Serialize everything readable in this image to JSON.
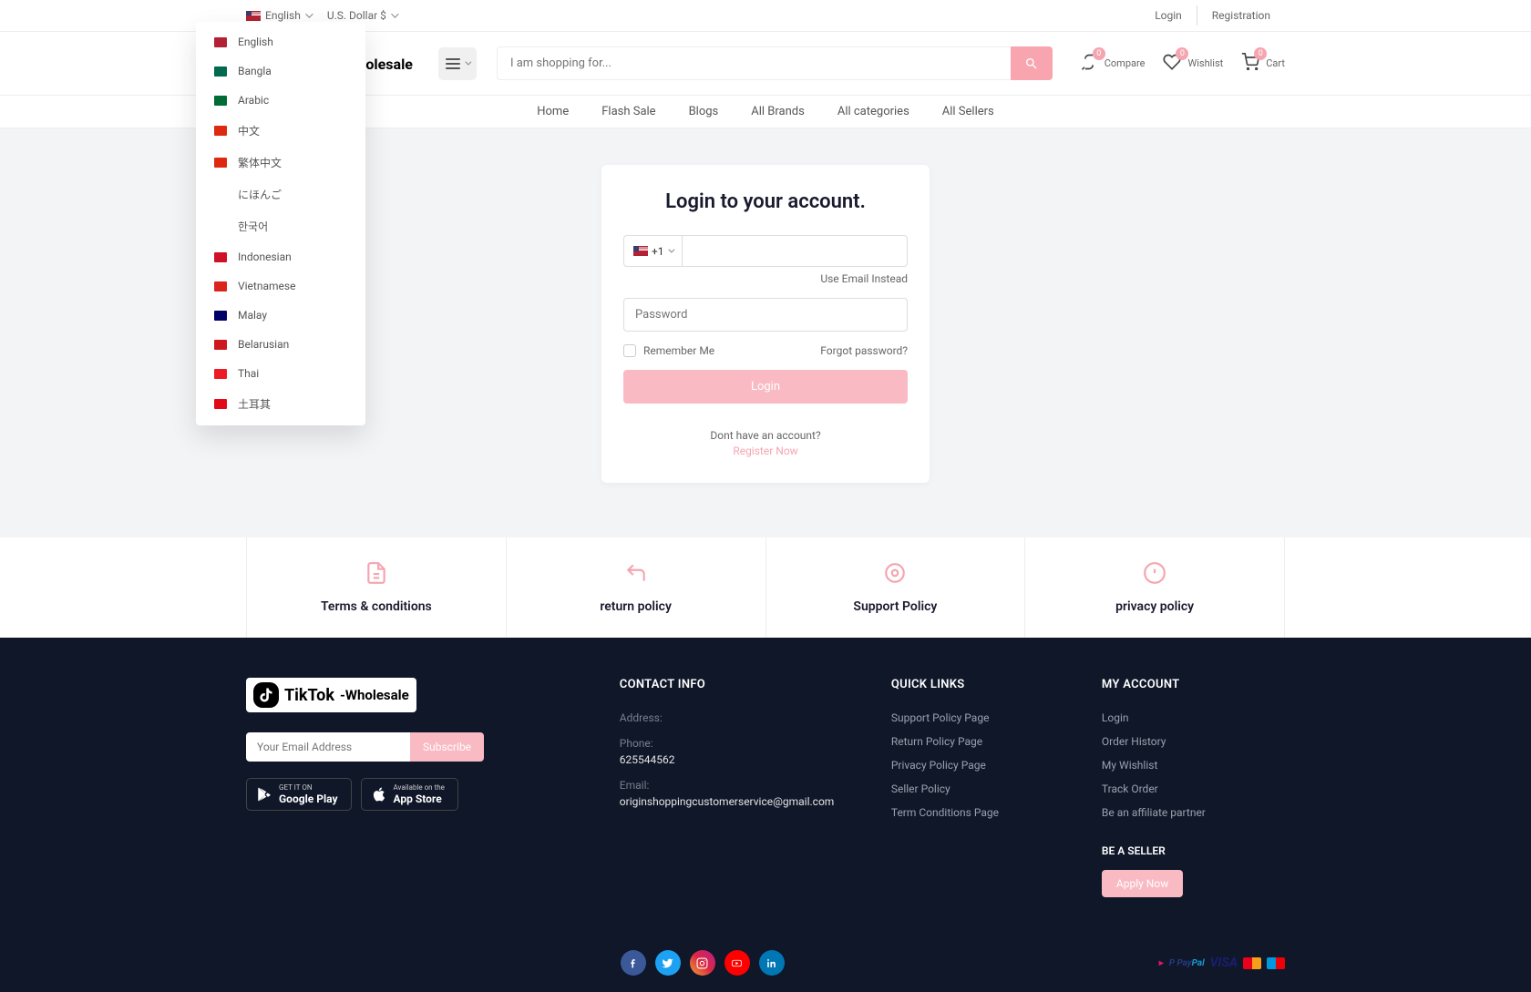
{
  "topbar": {
    "language": "English",
    "currency": "U.S. Dollar $",
    "login": "Login",
    "registration": "Registration"
  },
  "language_dropdown": [
    "English",
    "Bangla",
    "Arabic",
    "中文",
    "繁体中文",
    "にほんご",
    "한국어",
    "Indonesian",
    "Vietnamese",
    "Malay",
    "Belarusian",
    "Thai",
    "土耳其"
  ],
  "header": {
    "logo_brand": "TikTok",
    "logo_suffix": "-Wholesale",
    "search_placeholder": "I am shopping for...",
    "compare_label": "Compare",
    "compare_count": "0",
    "wishlist_label": "Wishlist",
    "wishlist_count": "0",
    "cart_label": "Cart",
    "cart_count": "0"
  },
  "nav": [
    "Home",
    "Flash Sale",
    "Blogs",
    "All Brands",
    "All categories",
    "All Sellers"
  ],
  "login_form": {
    "title": "Login to your account.",
    "dial_code": "+1",
    "use_email": "Use Email Instead",
    "password_placeholder": "Password",
    "remember_label": "Remember Me",
    "forgot": "Forgot password?",
    "login_button": "Login",
    "no_account": "Dont have an account?",
    "register_now": "Register Now"
  },
  "policies": [
    "Terms & conditions",
    "return policy",
    "Support Policy",
    "privacy policy"
  ],
  "footer": {
    "newsletter_placeholder": "Your Email Address",
    "subscribe": "Subscribe",
    "google_play_top": "GET IT ON",
    "google_play": "Google Play",
    "app_store_top": "Available on the",
    "app_store": "App Store",
    "contact_heading": "CONTACT INFO",
    "address_label": "Address:",
    "phone_label": "Phone:",
    "phone_value": "625544562",
    "email_label": "Email:",
    "email_value": "originshoppingcustomerservice@gmail.com",
    "quick_heading": "QUICK LINKS",
    "quick_links": [
      "Support Policy Page",
      "Return Policy Page",
      "Privacy Policy Page",
      "Seller Policy",
      "Term Conditions Page"
    ],
    "account_heading": "MY ACCOUNT",
    "account_links": [
      "Login",
      "Order History",
      "My Wishlist",
      "Track Order",
      "Be an affiliate partner"
    ],
    "be_seller": "BE A SELLER",
    "apply_now": "Apply Now"
  }
}
